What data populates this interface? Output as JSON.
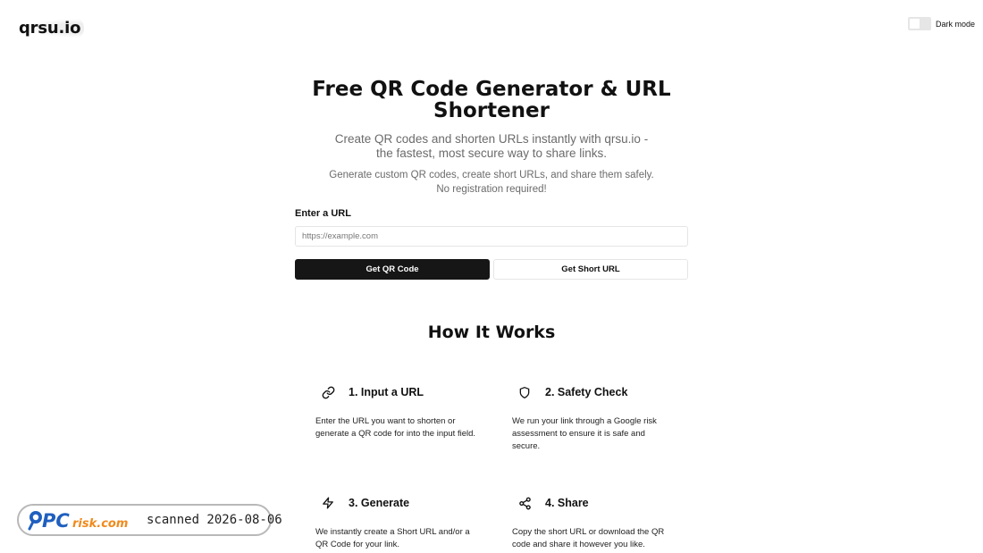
{
  "header": {
    "logo": "qrsu.io",
    "dark_mode_label": "Dark mode"
  },
  "hero": {
    "title": "Free QR Code Generator & URL Shortener",
    "subtitle": "Create QR codes and shorten URLs instantly with qrsu.io - the fastest, most secure way to share links.",
    "description": "Generate custom QR codes, create short URLs, and share them safely. No registration required!"
  },
  "form": {
    "label": "Enter a URL",
    "placeholder": "https://example.com",
    "value": "",
    "qr_button": "Get QR Code",
    "short_button": "Get Short URL"
  },
  "how": {
    "title": "How It Works",
    "steps": [
      {
        "icon": "link-icon",
        "title": "1. Input a URL",
        "desc": "Enter the URL you want to shorten or generate a QR code for into the input field."
      },
      {
        "icon": "shield-icon",
        "title": "2. Safety Check",
        "desc": "We run your link through a Google risk assessment to ensure it is safe and secure."
      },
      {
        "icon": "lightning-icon",
        "title": "3. Generate",
        "desc": "We instantly create a Short URL and/or a QR Code for your link."
      },
      {
        "icon": "share-icon",
        "title": "4. Share",
        "desc": "Copy the short URL or download the QR code and share it however you like."
      }
    ]
  },
  "watermark": {
    "brand": "PCrisk.com",
    "text": "scanned 2026-08-06"
  },
  "colors": {
    "primary_button": "#161616",
    "muted_text": "#6b6b6b",
    "border": "#e5e5e5",
    "watermark_blue": "#1f5fbf",
    "watermark_orange": "#f08a1c"
  }
}
